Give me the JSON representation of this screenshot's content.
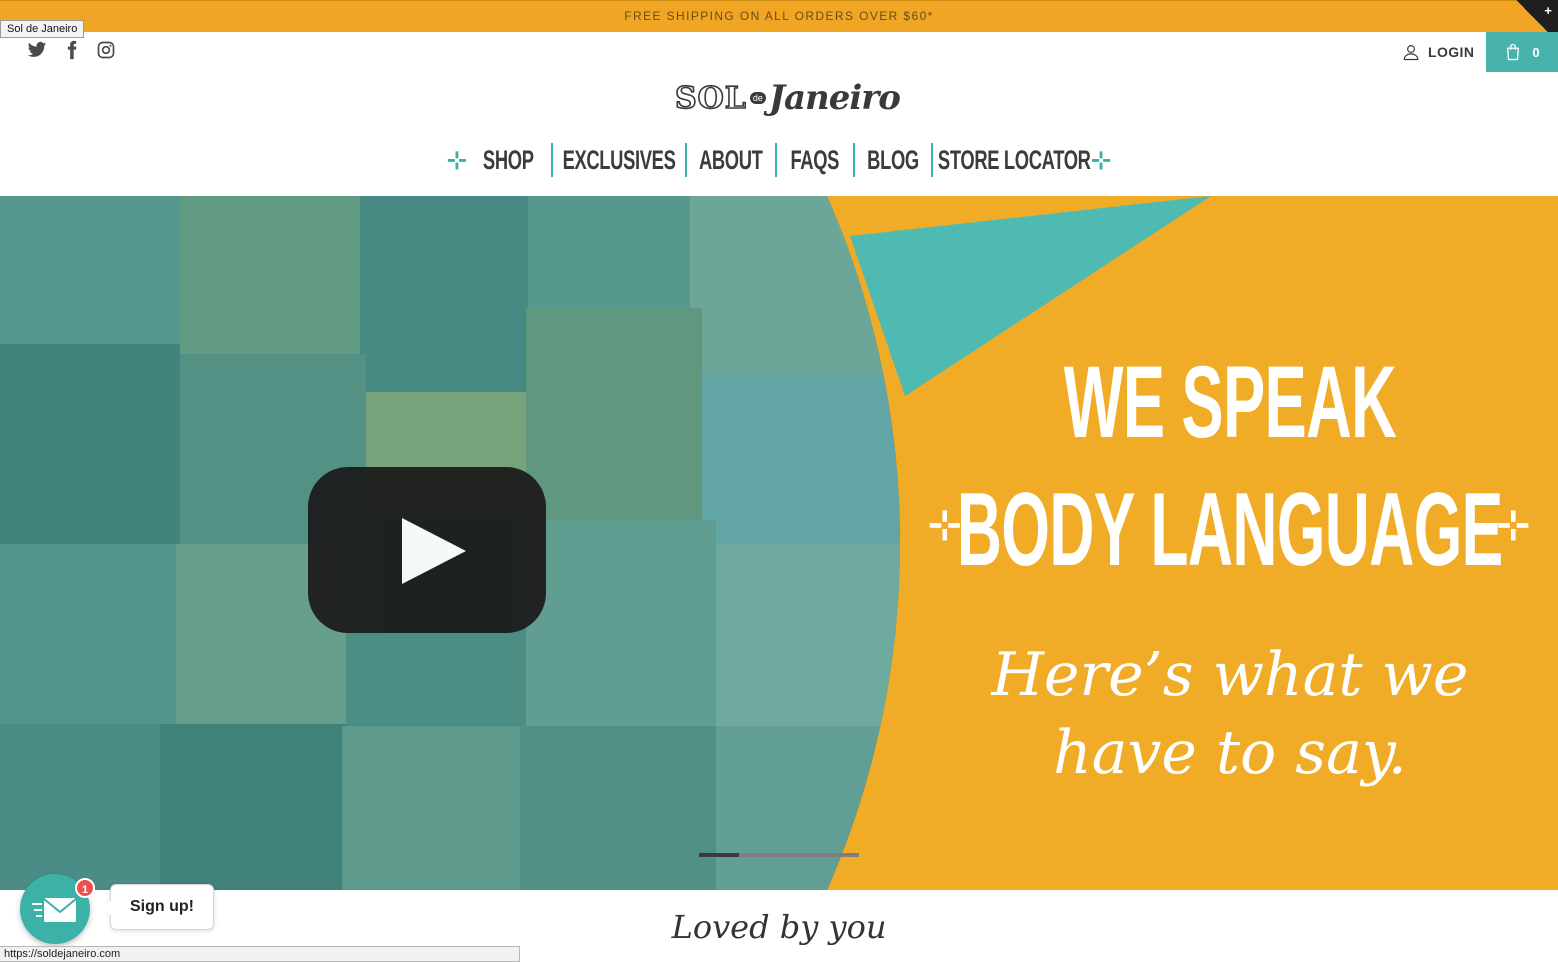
{
  "tooltip": {
    "title": "Sol de Janeiro"
  },
  "promo": {
    "text": "FREE SHIPPING ON ALL ORDERS OVER $60*"
  },
  "corner_badge": {
    "icon": "plus-icon",
    "glyph": "+"
  },
  "social": [
    {
      "name": "twitter-icon"
    },
    {
      "name": "facebook-icon"
    },
    {
      "name": "instagram-icon"
    }
  ],
  "header": {
    "login_label": "LOGIN",
    "cart_count": "0",
    "cart_color": "#48b3ad",
    "logo": {
      "sol": "SOL",
      "de": "de",
      "janeiro": "Janeiro"
    }
  },
  "nav": {
    "ornament_left": "⊹",
    "ornament_right": "⊹",
    "items": [
      {
        "label": "SHOP"
      },
      {
        "label": "EXCLUSIVES"
      },
      {
        "label": "ABOUT"
      },
      {
        "label": "FAQS"
      },
      {
        "label": "BLOG"
      },
      {
        "label": "STORE LOCATOR"
      }
    ],
    "accent_color": "#3bb1a8"
  },
  "hero": {
    "headline_1": "WE SPEAK",
    "headline_2": "BODY LANGUAGE",
    "ornament_left": "⊹",
    "ornament_right": "⊹",
    "subline_1": "Here’s what we",
    "subline_2": "have to say.",
    "background_color": "#f0ab27",
    "video_progress": 0.25,
    "play_icon": "play-icon"
  },
  "section": {
    "loved_title": "Loved by you"
  },
  "chat": {
    "badge_count": "1",
    "signup_label": "Sign up!",
    "icon": "envelope-icon"
  },
  "status_bar": {
    "url": "https://soldejaneiro.com"
  }
}
